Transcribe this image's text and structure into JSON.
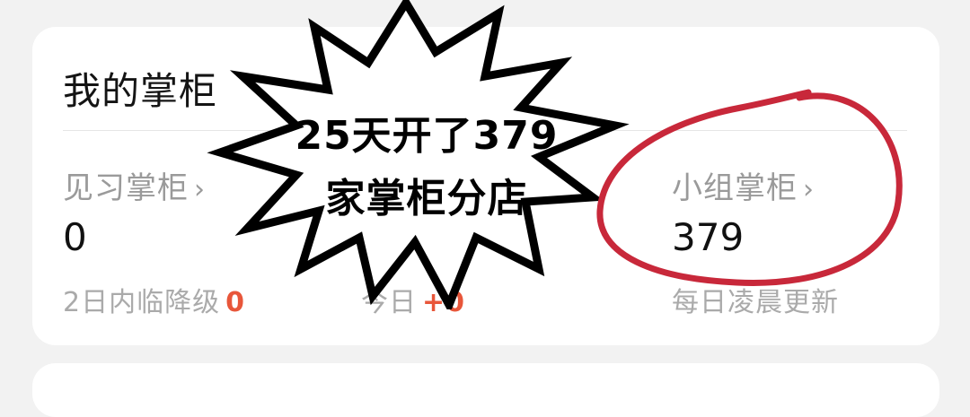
{
  "card": {
    "title": "我的掌柜",
    "columns": [
      {
        "label": "见习掌柜",
        "chevron": "›",
        "value": "0",
        "sub_text": "2日内临降级",
        "sub_accent": "0"
      },
      {
        "sub_text": "今日",
        "sub_accent": "+0"
      },
      {
        "label": "小组掌柜",
        "chevron": "›",
        "value": "379",
        "sub_text": "每日凌晨更新"
      }
    ]
  },
  "sticker": {
    "line1": "25天开了379",
    "line2": "家掌柜分店"
  },
  "annotation": {
    "circle_color": "#c8283a"
  },
  "colors": {
    "accent": "#e8563a",
    "background": "#f2f2f2",
    "card": "#ffffff"
  }
}
